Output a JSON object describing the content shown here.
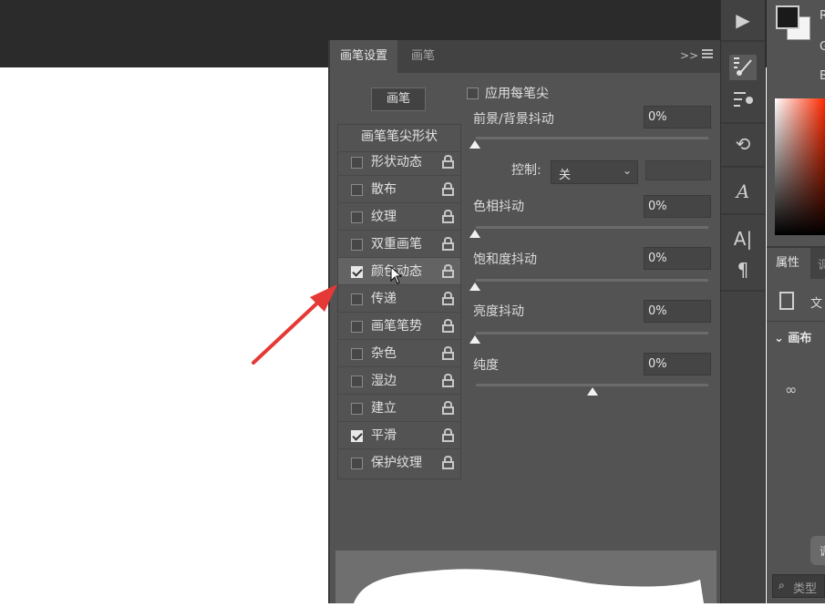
{
  "panel": {
    "tabs": [
      {
        "label": "画笔设置",
        "active": true
      },
      {
        "label": "画笔",
        "active": false
      }
    ],
    "collapse_icon": "double-chevron-right-icon",
    "brush_button": "画笔",
    "list_header": "画笔笔尖形状",
    "items": [
      {
        "label": "形状动态",
        "checked": false
      },
      {
        "label": "散布",
        "checked": false
      },
      {
        "label": "纹理",
        "checked": false
      },
      {
        "label": "双重画笔",
        "checked": false
      },
      {
        "label": "颜色动态",
        "checked": true,
        "highlighted": true
      },
      {
        "label": "传递",
        "checked": false
      },
      {
        "label": "画笔笔势",
        "checked": false
      },
      {
        "label": "杂色",
        "checked": false
      },
      {
        "label": "湿边",
        "checked": false
      },
      {
        "label": "建立",
        "checked": false
      },
      {
        "label": "平滑",
        "checked": true
      },
      {
        "label": "保护纹理",
        "checked": false
      }
    ],
    "apply_per_tip": {
      "label": "应用每笔尖",
      "checked": false
    },
    "params": [
      {
        "label": "前景/背景抖动",
        "value": "0%",
        "slider": 0
      },
      {
        "label": "色相抖动",
        "value": "0%",
        "slider": 0
      },
      {
        "label": "饱和度抖动",
        "value": "0%",
        "slider": 0
      },
      {
        "label": "亮度抖动",
        "value": "0%",
        "slider": 0
      },
      {
        "label": "纯度",
        "value": "0%",
        "slider": 0.5
      }
    ],
    "control": {
      "label": "控制:",
      "value": "关"
    }
  },
  "color_panel": {
    "r_label": "R",
    "g_label": "G",
    "b_label": "B",
    "foreground": "#1a1a1a",
    "background": "#f4f4f4"
  },
  "properties_panel": {
    "tab": "属性",
    "tab2": "调",
    "doc_label": "文",
    "section": "画布",
    "button_label": "调",
    "search_placeholder": "类型"
  },
  "colors": {
    "arrow": "#e53935",
    "panel_bg": "#535353"
  }
}
